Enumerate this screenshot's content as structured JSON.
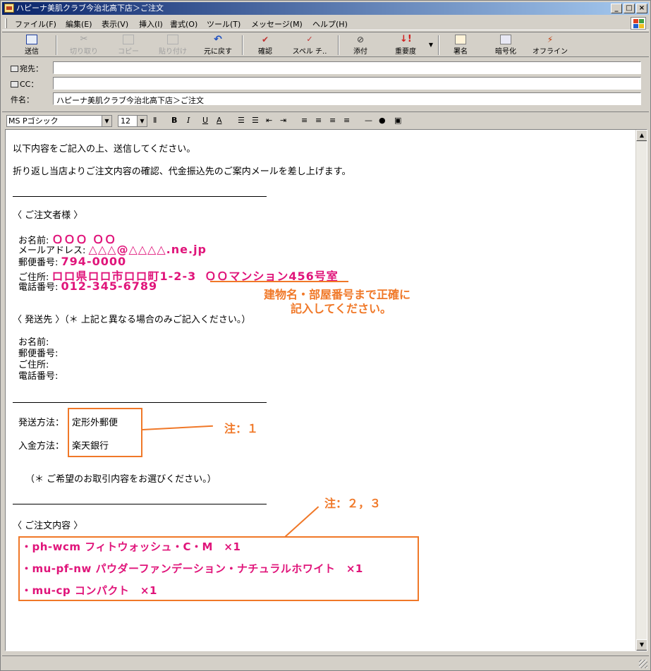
{
  "window": {
    "title": "ハピーナ美肌クラブ今治北高下店＞ご注文"
  },
  "menu": [
    "ファイル(F)",
    "編集(E)",
    "表示(V)",
    "挿入(I)",
    "書式(O)",
    "ツール(T)",
    "メッセージ(M)",
    "ヘルプ(H)"
  ],
  "toolbar": {
    "send": "送信",
    "cut": "切り取り",
    "copy": "コピー",
    "paste": "貼り付け",
    "undo": "元に戻す",
    "check": "確認",
    "spell": "スペル チ..",
    "attach": "添付",
    "priority": "重要度",
    "sign": "署名",
    "encrypt": "暗号化",
    "offline": "オフライン"
  },
  "header": {
    "to_label": "宛先：",
    "to_value": "",
    "cc_label": "CC：",
    "cc_value": "",
    "subject_label": "件名：",
    "subject_value": "ハピーナ美肌クラブ今治北高下店＞ご注文"
  },
  "format": {
    "font": "MS Pゴシック",
    "size": "12",
    "bold": "B",
    "italic": "I",
    "underline": "U",
    "color": "A"
  },
  "body": {
    "intro1": "以下内容をご記入の上、送信してください。",
    "intro2": "折り返し当店よりご注文内容の確認、代金振込先のご案内メールを差し上げます。",
    "orderer_heading": "〈 ご注文者様 〉",
    "name_label": "お名前:",
    "name_value": "ＯＯＯ ＯＯ",
    "email_label": "メールアドレス:",
    "email_value": "△△△@△△△△.ne.jp",
    "zip_label": "郵便番号:",
    "zip_value": "794-0000",
    "address_label": "ご住所:",
    "address_value": "ロロ県ロロ市ロロ町1-2-3",
    "address_building": "ＯＯマンション456号室",
    "phone_label": "電話番号:",
    "phone_value": "012-345-6789",
    "address_note_1": "建物名・部屋番号まで正確に",
    "address_note_2": "記入してください。",
    "ship_heading": "〈 発送先 〉（＊ 上記と異なる場合のみご記入ください。）",
    "ship_name_label": "お名前:",
    "ship_zip_label": "郵便番号:",
    "ship_address_label": "ご住所:",
    "ship_phone_label": "電話番号:",
    "shipping_label": "発送方法：",
    "shipping_value": "定形外郵便",
    "payment_label": "入金方法：",
    "payment_value": "楽天銀行",
    "note1": "注：１",
    "select_note": "（＊ ご希望のお取引内容をお選びください。）",
    "order_heading": "〈 ご注文内容 〉",
    "note23": "注：２，３",
    "items": [
      "・ph-wcm フィトウォッシュ・C・M　×1",
      "・mu-pf-nw パウダーファンデーション・ナチュラルホワイト　×1",
      "・mu-cp コンパクト　×1"
    ]
  },
  "colors": {
    "accent": "#f07828",
    "highlight": "#e0147a",
    "titlebar": "#0a246a"
  }
}
